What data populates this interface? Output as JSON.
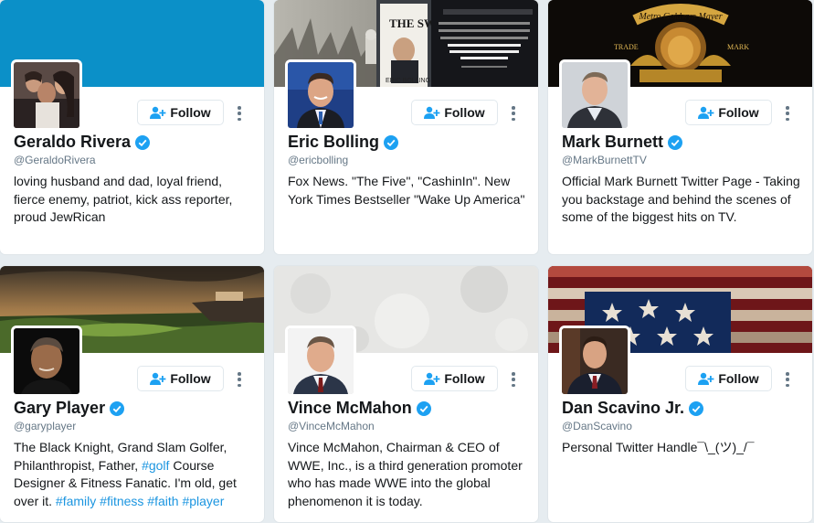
{
  "follow_label": "Follow",
  "accent_color": "#1da1f2",
  "cards": [
    {
      "name": "Geraldo Rivera",
      "handle": "@GeraldoRivera",
      "bio": "loving husband and dad, loyal friend, fierce enemy, patriot, kick ass reporter, proud JewRican",
      "verified": true
    },
    {
      "name": "Eric Bolling",
      "handle": "@ericbolling",
      "bio": "Fox News. \"The Five\", \"CashinIn\". New York Times Bestseller \"Wake Up America\"",
      "verified": true,
      "banner_text": {
        "book_title": "THE SWAMP",
        "book_tagline": "WASHINGTON'S MURKY POOL OF CORRUPTION AND CRONYISM — AND HOW TRUMP CAN DRAIN IT",
        "author": "ERIC BOLLING"
      }
    },
    {
      "name": "Mark Burnett",
      "handle": "@MarkBurnettTV",
      "bio": "Official Mark Burnett Twitter Page - Taking you backstage and behind the scenes of some of the biggest hits on TV.",
      "verified": true,
      "banner_text": {
        "logo": "Metro Goldwyn Mayer",
        "left": "TRADE",
        "right": "MARK"
      }
    },
    {
      "name": "Gary Player",
      "handle": "@garyplayer",
      "bio_parts": [
        "The Black Knight, Grand Slam Golfer, Philanthropist, Father, ",
        "#golf",
        " Course Designer & Fitness Fanatic. I'm old, get over it. ",
        "#family",
        " ",
        "#fitness",
        " ",
        "#faith",
        " ",
        "#player"
      ],
      "verified": true
    },
    {
      "name": "Vince McMahon",
      "handle": "@VinceMcMahon",
      "bio": "Vince McMahon, Chairman & CEO of WWE, Inc., is a third generation promoter who has made WWE into the global phenomenon it is today.",
      "verified": true
    },
    {
      "name": "Dan Scavino Jr.",
      "handle": "@DanScavino",
      "bio": "Personal Twitter Handle¯\\_(ツ)_/¯",
      "verified": true
    }
  ]
}
